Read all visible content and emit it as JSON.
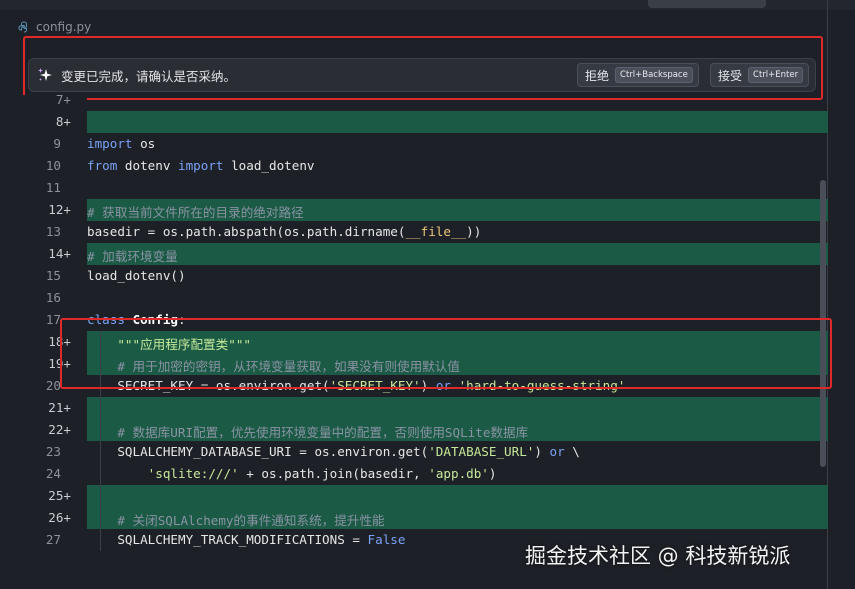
{
  "file": {
    "name": "config.py",
    "icon": "python-file-icon"
  },
  "banner": {
    "message": "变更已完成，请确认是否采纳。",
    "reject": {
      "label": "拒绝",
      "shortcut": "Ctrl+Backspace"
    },
    "accept": {
      "label": "接受",
      "shortcut": "Ctrl+Enter"
    }
  },
  "lines": [
    {
      "num": "7+",
      "added": false,
      "text": ""
    },
    {
      "num": "8+",
      "added": true,
      "text": ""
    },
    {
      "num": "9",
      "added": false,
      "text": "import os"
    },
    {
      "num": "10",
      "added": false,
      "text": "from dotenv import load_dotenv"
    },
    {
      "num": "11",
      "added": false,
      "text": ""
    },
    {
      "num": "12+",
      "added": true,
      "text": "# 获取当前文件所在的目录的绝对路径"
    },
    {
      "num": "13",
      "added": false,
      "text": "basedir = os.path.abspath(os.path.dirname(__file__))"
    },
    {
      "num": "14+",
      "added": true,
      "text": "# 加载环境变量"
    },
    {
      "num": "15",
      "added": false,
      "text": "load_dotenv()"
    },
    {
      "num": "16",
      "added": false,
      "text": ""
    },
    {
      "num": "17",
      "added": false,
      "text": "class Config:"
    },
    {
      "num": "18+",
      "added": true,
      "text": "    \"\"\"应用程序配置类\"\"\""
    },
    {
      "num": "19+",
      "added": true,
      "text": "    # 用于加密的密钥，从环境变量获取，如果没有则使用默认值"
    },
    {
      "num": "20",
      "added": false,
      "text": "    SECRET_KEY = os.environ.get('SECRET_KEY') or 'hard-to-guess-string'"
    },
    {
      "num": "21+",
      "added": true,
      "text": ""
    },
    {
      "num": "22+",
      "added": true,
      "text": "    # 数据库URI配置，优先使用环境变量中的配置，否则使用SQLite数据库"
    },
    {
      "num": "23",
      "added": false,
      "text": "    SQLALCHEMY_DATABASE_URI = os.environ.get('DATABASE_URL') or \\"
    },
    {
      "num": "24",
      "added": false,
      "text": "        'sqlite:///' + os.path.join(basedir, 'app.db')"
    },
    {
      "num": "25+",
      "added": true,
      "text": ""
    },
    {
      "num": "26+",
      "added": true,
      "text": "    # 关闭SQLAlchemy的事件通知系统，提升性能"
    },
    {
      "num": "27",
      "added": false,
      "text": "    SQLALCHEMY_TRACK_MODIFICATIONS = False"
    }
  ],
  "watermark": "掘金技术社区 @ 科技新锐派",
  "colors": {
    "added_bg": "#1b5a45",
    "highlight": "#e02a2a",
    "keyword": "#7aa2f7",
    "string": "#c6e89a"
  }
}
